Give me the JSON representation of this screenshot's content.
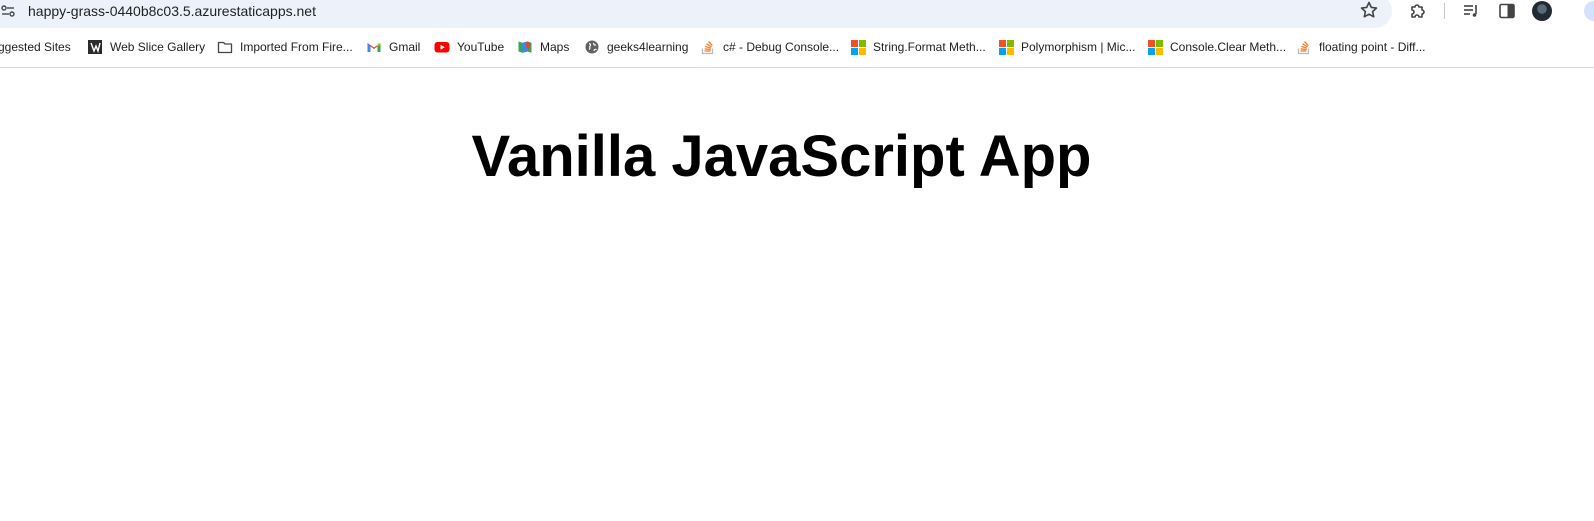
{
  "browser": {
    "url": "happy-grass-0440b8c03.5.azurestaticapps.net",
    "toolbar_icons": [
      "site-info-icon",
      "star-icon",
      "extensions-icon",
      "reading-list-icon",
      "side-panel-icon",
      "profile-avatar"
    ]
  },
  "bookmarks": [
    {
      "label": "ggested Sites",
      "icon": "none"
    },
    {
      "label": "Web Slice Gallery",
      "icon": "web-slice-icon"
    },
    {
      "label": "Imported From Fire...",
      "icon": "folder-icon"
    },
    {
      "label": "Gmail",
      "icon": "gmail-icon"
    },
    {
      "label": "YouTube",
      "icon": "youtube-icon"
    },
    {
      "label": "Maps",
      "icon": "maps-icon"
    },
    {
      "label": "geeks4learning",
      "icon": "globe-icon"
    },
    {
      "label": "c# - Debug Console...",
      "icon": "stackoverflow-icon"
    },
    {
      "label": "String.Format Meth...",
      "icon": "microsoft-icon"
    },
    {
      "label": "Polymorphism | Mic...",
      "icon": "microsoft-icon"
    },
    {
      "label": "Console.Clear Meth...",
      "icon": "microsoft-icon"
    },
    {
      "label": "floating point - Diff...",
      "icon": "stackoverflow-icon"
    }
  ],
  "page": {
    "title": "Vanilla JavaScript App"
  },
  "colors": {
    "omnibox_bg": "#edf2fa",
    "youtube_red": "#ff0000",
    "stackoverflow_orange": "#f48024",
    "ms_red": "#f25022",
    "ms_green": "#7fba00",
    "ms_blue": "#00a4ef",
    "ms_yellow": "#ffb900"
  }
}
